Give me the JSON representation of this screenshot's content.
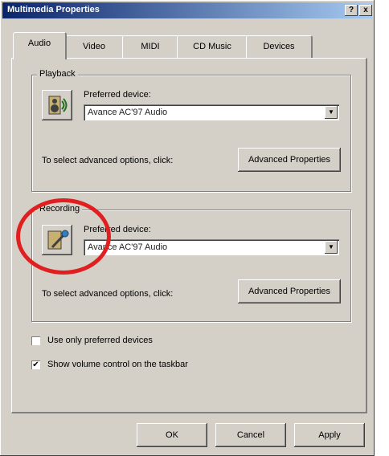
{
  "window": {
    "title": "Multimedia Properties",
    "help_glyph": "?",
    "close_glyph": "x"
  },
  "tabs": [
    {
      "label": "Audio",
      "active": true
    },
    {
      "label": "Video",
      "active": false
    },
    {
      "label": "MIDI",
      "active": false
    },
    {
      "label": "CD Music",
      "active": false
    },
    {
      "label": "Devices",
      "active": false
    }
  ],
  "playback": {
    "group_label": "Playback",
    "preferred_device_label": "Preferred device:",
    "device_value": "Avance AC'97 Audio",
    "advanced_text": "To select advanced options, click:",
    "advanced_button": "Advanced Properties"
  },
  "recording": {
    "group_label": "Recording",
    "preferred_device_label": "Preferred device:",
    "device_value": "Avance AC'97 Audio",
    "advanced_text": "To select advanced options, click:",
    "advanced_button": "Advanced Properties"
  },
  "options": {
    "use_preferred_label": "Use only preferred devices",
    "use_preferred_checked": false,
    "show_volume_label": "Show volume control on the taskbar",
    "show_volume_checked": true,
    "check_glyph": "✔"
  },
  "buttons": {
    "ok": "OK",
    "cancel": "Cancel",
    "apply": "Apply"
  },
  "annotation": {
    "color": "#e02020"
  },
  "colors": {
    "titlebar_start": "#0a246a",
    "titlebar_end": "#a6caf0",
    "face": "#d4d0c8"
  }
}
